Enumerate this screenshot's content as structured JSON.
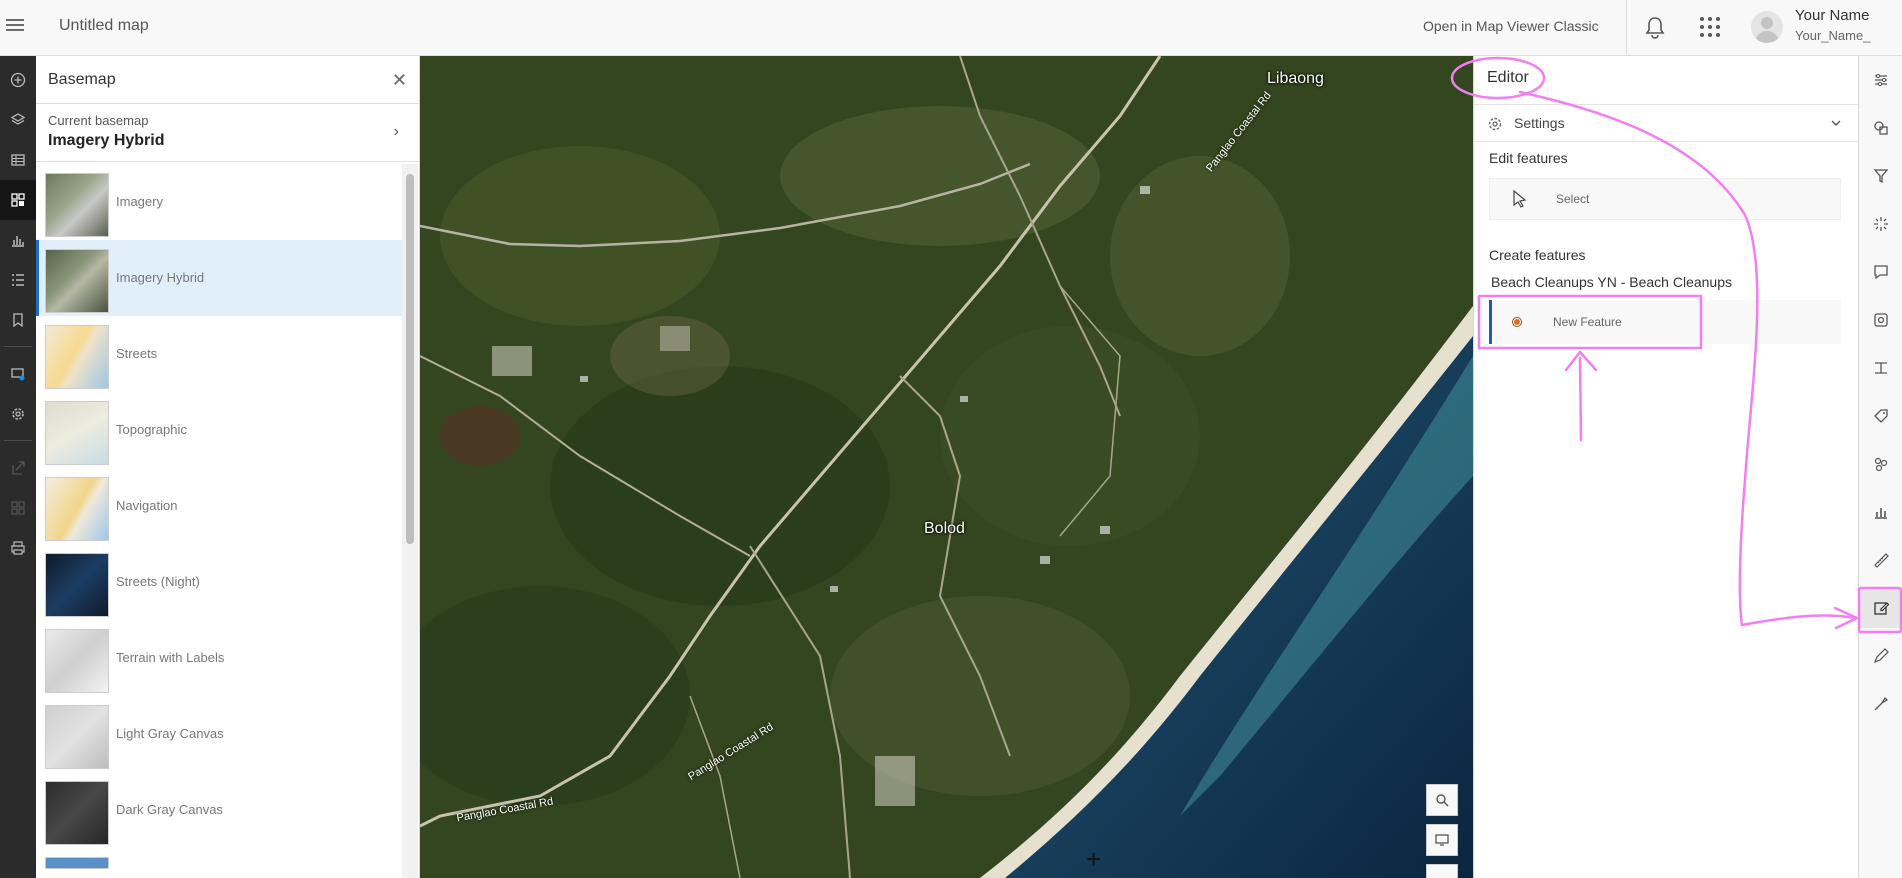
{
  "header": {
    "menu_icon": "hamburger-menu-icon",
    "title": "Untitled map",
    "open_classic": "Open in Map Viewer Classic",
    "notifications_icon": "bell-icon",
    "apps_icon": "app-launcher-grid-icon",
    "user_name": "Your Name",
    "user_handle": "Your_Name_"
  },
  "left_toolbar": {
    "items": [
      "add-layer-icon",
      "layers-icon",
      "tables-icon",
      "basemap-icon",
      "charts-icon",
      "legend-icon",
      "bookmarks-icon",
      "sketch-icon",
      "map-properties-icon",
      "share-icon",
      "qr-icon",
      "print-icon"
    ],
    "active": "basemap-icon"
  },
  "basemap_panel": {
    "title": "Basemap",
    "close_icon": "close-icon",
    "current_label": "Current basemap",
    "current_value": "Imagery Hybrid",
    "items": [
      {
        "name": "Imagery"
      },
      {
        "name": "Imagery Hybrid"
      },
      {
        "name": "Streets"
      },
      {
        "name": "Topographic"
      },
      {
        "name": "Navigation"
      },
      {
        "name": "Streets (Night)"
      },
      {
        "name": "Terrain with Labels"
      },
      {
        "name": "Light Gray Canvas"
      },
      {
        "name": "Dark Gray Canvas"
      }
    ],
    "selected": "Imagery Hybrid"
  },
  "map": {
    "places": {
      "libaong": "Libaong",
      "bolod": "Bolod"
    },
    "roads": {
      "r1": "Panglao Coastal Rd",
      "r2": "Panglao Coastal Rd",
      "r3": "Panglao Coastal Rd"
    },
    "controls": [
      "search-icon",
      "screen-icon"
    ]
  },
  "editor": {
    "title": "Editor",
    "settings_label": "Settings",
    "edit_features_title": "Edit features",
    "select_label": "Select",
    "create_features_title": "Create features",
    "layer_name": "Beach Cleanups YN - Beach Cleanups",
    "new_feature_label": "New Feature"
  },
  "right_toolbar": {
    "items": [
      "properties-icon",
      "styles-icon",
      "filter-icon",
      "effects-icon",
      "pop-ups-icon",
      "configure-pop-ups-icon",
      "fields-icon",
      "labels-icon",
      "clustering-icon",
      "aggregation-icon",
      "measure-icon",
      "edit-icon",
      "sketch-pen-icon",
      "analysis-icon"
    ],
    "active": "edit-icon"
  },
  "colors": {
    "accent": "#1b6fc7",
    "annotation": "#f27ef2",
    "selected_bg": "#e1effb"
  }
}
